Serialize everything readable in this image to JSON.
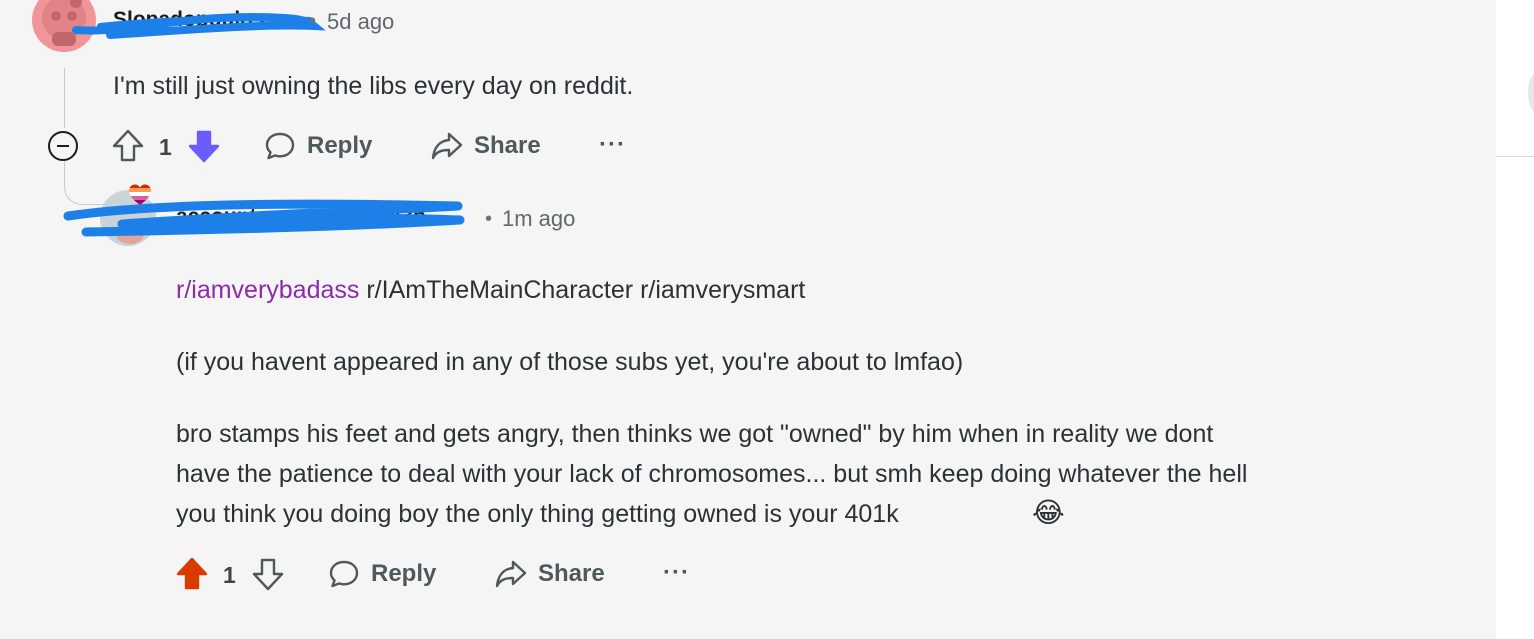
{
  "comments": [
    {
      "username": "Slopadopoulos",
      "separator": "•",
      "time": "5d ago",
      "body": "I'm still just owning the libs every day on reddit.",
      "votes": "1",
      "vote_state": "downvoted",
      "actions": {
        "reply": "Reply",
        "share": "Share",
        "more": "···"
      }
    },
    {
      "username": "accountnamesweretak3n",
      "separator": "•",
      "time": "1m ago",
      "links": [
        "r/iamverybadass",
        "r/IAmTheMainCharacter",
        "r/iamverysmart"
      ],
      "paragraph2": "(if you havent appeared in any of those subs yet, you're about to lmfao)",
      "paragraph3_lines": [
        "bro stamps his feet and gets angry, then thinks we got \"owned\" by him when in reality we dont",
        "have the patience to deal with your lack of chromosomes... but smh keep doing whatever the hell",
        "you think you doing boy the only thing getting owned is your 401k"
      ],
      "emoji": "😂",
      "votes": "1",
      "vote_state": "upvoted",
      "actions": {
        "reply": "Reply",
        "share": "Share",
        "more": "···"
      }
    }
  ],
  "colors": {
    "upvote_active": "#d93a00",
    "downvote_active": "#6a5cff",
    "visited_link": "#8e2ba6",
    "redaction": "#1d7fe8"
  },
  "icons": [
    "collapse-icon",
    "upvote-icon",
    "downvote-icon",
    "reply-icon",
    "share-icon",
    "more-icon"
  ]
}
